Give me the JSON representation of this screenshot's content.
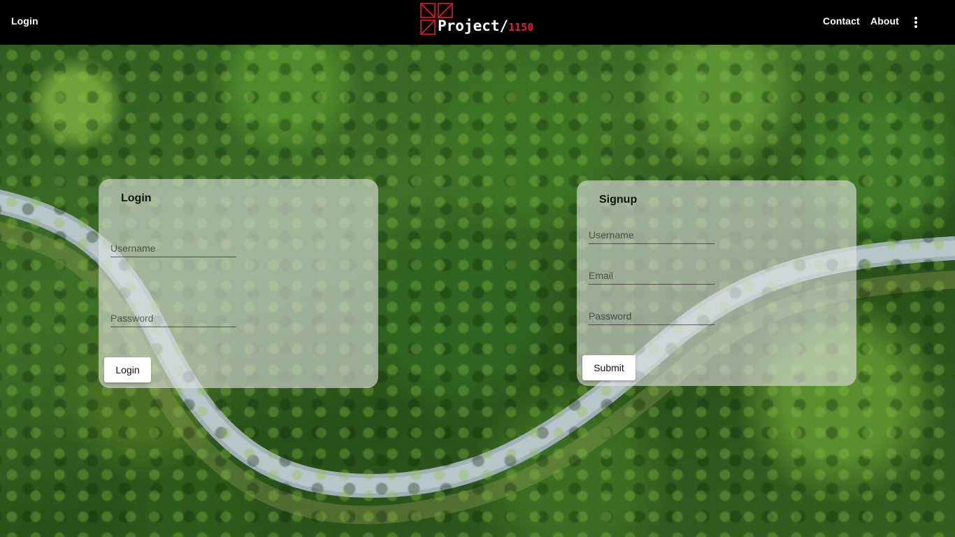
{
  "header": {
    "login_link": "Login",
    "contact_link": "Contact",
    "about_link": "About",
    "logo": {
      "name": "Project/",
      "number": "1150"
    },
    "more_icon": "more-vertical-icon"
  },
  "login_card": {
    "title": "Login",
    "username_placeholder": "Username",
    "password_placeholder": "Password",
    "button_label": "Login"
  },
  "signup_card": {
    "title": "Signup",
    "username_placeholder": "Username",
    "email_placeholder": "Email",
    "password_placeholder": "Password",
    "button_label": "Submit"
  },
  "colors": {
    "header_bg": "#000000",
    "logo_accent": "#e3182b",
    "card_bg": "rgba(225,225,225,0.62)"
  }
}
